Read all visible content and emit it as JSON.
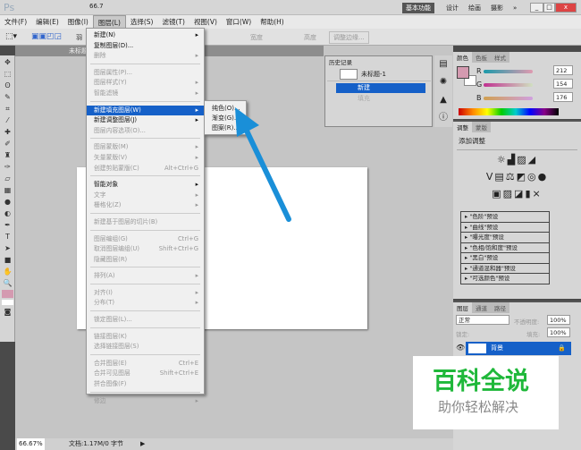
{
  "app": {
    "logo": "Ps",
    "zoom": "66.7",
    "workspaces": [
      "基本功能",
      "设计",
      "绘画",
      "摄影"
    ],
    "more": "»"
  },
  "menubar": [
    "文件(F)",
    "编辑(E)",
    "图像(I)",
    "图层(L)",
    "选择(S)",
    "滤镜(T)",
    "视图(V)",
    "窗口(W)",
    "帮助(H)"
  ],
  "options": {
    "feather_label": "羽",
    "width_label": "宽度",
    "height_label": "高度",
    "refine_edge": "调整边缘..."
  },
  "document": {
    "tab": "未标题-1 @ 66.7%(RGB/8)",
    "zoom": "66.67%",
    "status": "文档:1.17M/0 字节"
  },
  "layer_menu": [
    {
      "label": "新建(N)",
      "arrow": true,
      "enabled": true
    },
    {
      "label": "复制图层(D)...",
      "enabled": true
    },
    {
      "label": "删除",
      "arrow": true
    },
    {
      "sep": true
    },
    {
      "label": "图层属性(P)..."
    },
    {
      "label": "图层样式(Y)",
      "arrow": true
    },
    {
      "label": "智能滤镜",
      "arrow": true
    },
    {
      "sep": true
    },
    {
      "label": "新建填充图层(W)",
      "arrow": true,
      "enabled": true,
      "highlight": true
    },
    {
      "label": "新建调整图层(J)",
      "arrow": true,
      "enabled": true
    },
    {
      "label": "图层内容选项(O)..."
    },
    {
      "sep": true
    },
    {
      "label": "图层蒙版(M)",
      "arrow": true
    },
    {
      "label": "矢量蒙版(V)",
      "arrow": true
    },
    {
      "label": "创建剪贴蒙版(C)",
      "shortcut": "Alt+Ctrl+G"
    },
    {
      "sep": true
    },
    {
      "label": "智能对象",
      "arrow": true,
      "enabled": true
    },
    {
      "label": "文字",
      "arrow": true
    },
    {
      "label": "栅格化(Z)",
      "arrow": true
    },
    {
      "sep": true
    },
    {
      "label": "新建基于图层的切片(B)"
    },
    {
      "sep": true
    },
    {
      "label": "图层编组(G)",
      "shortcut": "Ctrl+G"
    },
    {
      "label": "取消图层编组(U)",
      "shortcut": "Shift+Ctrl+G"
    },
    {
      "label": "隐藏图层(R)"
    },
    {
      "sep": true
    },
    {
      "label": "排列(A)",
      "arrow": true
    },
    {
      "sep": true
    },
    {
      "label": "对齐(I)",
      "arrow": true
    },
    {
      "label": "分布(T)",
      "arrow": true
    },
    {
      "sep": true
    },
    {
      "label": "锁定图层(L)..."
    },
    {
      "sep": true
    },
    {
      "label": "链接图层(K)"
    },
    {
      "label": "选择链接图层(S)"
    },
    {
      "sep": true
    },
    {
      "label": "合并图层(E)",
      "shortcut": "Ctrl+E"
    },
    {
      "label": "合并可见图层",
      "shortcut": "Shift+Ctrl+E"
    },
    {
      "label": "拼合图像(F)"
    },
    {
      "sep": true
    },
    {
      "label": "修边",
      "arrow": true
    }
  ],
  "submenu": [
    "纯色(O)...",
    "渐变(G)...",
    "图案(R)..."
  ],
  "history": {
    "tab": "历史记录",
    "snapshot": "未标题-1",
    "items": [
      "新建",
      "填充"
    ]
  },
  "color": {
    "tabs": [
      "颜色",
      "色板",
      "样式"
    ],
    "r": 212,
    "g": 154,
    "b": 176,
    "fg": "#d49ab0"
  },
  "adjustments": {
    "tabs": [
      "调整",
      "蒙版"
    ],
    "title": "添加调整",
    "presets": [
      "\"色阶\"预设",
      "\"曲线\"预设",
      "\"曝光度\"预设",
      "\"色相/饱和度\"预设",
      "\"黑白\"预设",
      "\"通道混和器\"预设",
      "\"可选颜色\"预设"
    ]
  },
  "layers": {
    "tabs": [
      "图层",
      "通道",
      "路径"
    ],
    "blend": "正常",
    "opacity_label": "不透明度:",
    "opacity": "100%",
    "lock_label": "锁定:",
    "fill_label": "填充:",
    "fill": "100%",
    "layer_name": "背景"
  },
  "watermark": {
    "title": "百科全说",
    "subtitle": "助你轻松解决"
  },
  "colors": {
    "accent": "#1560c8",
    "arrow": "#1a8fd8",
    "watermark": "#1fb83a"
  }
}
